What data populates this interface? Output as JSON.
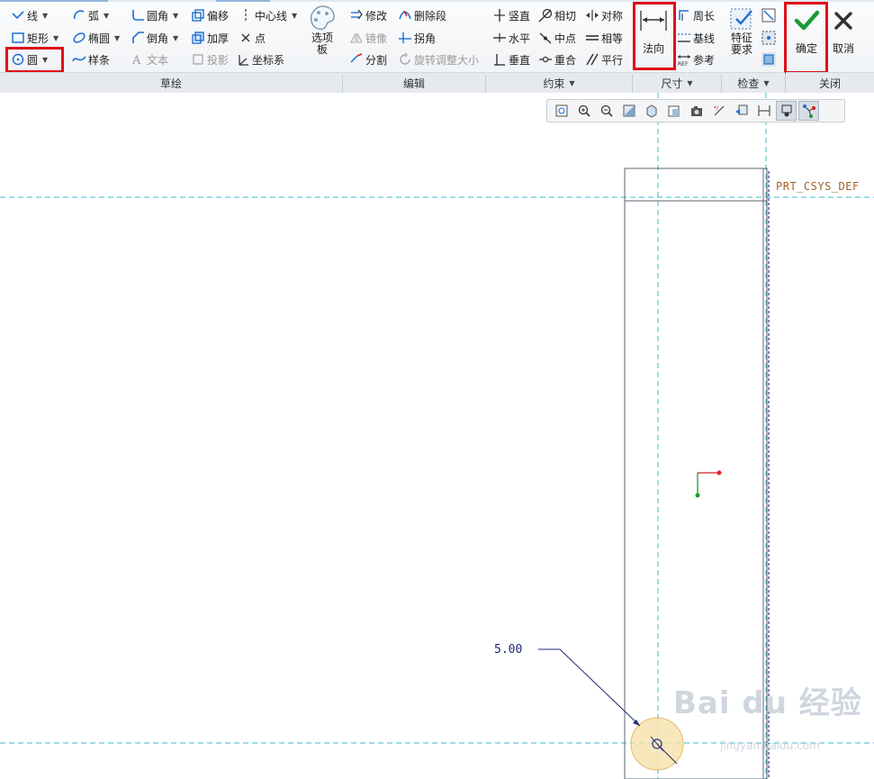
{
  "ribbon": {
    "sketch_tools": {
      "line": "线",
      "arc": "弧",
      "fillet": "圆角",
      "offset": "偏移",
      "centerline": "中心线",
      "rectangle": "矩形",
      "ellipse": "椭圆",
      "chamfer": "倒角",
      "thicken": "加厚",
      "point": "点",
      "circle": "圆",
      "spline": "样条",
      "text": "文本",
      "project": "投影",
      "coordinate_system": "坐标系",
      "palette": "选项板"
    },
    "edit_tools": {
      "modify": "修改",
      "delete_segment": "删除段",
      "mirror": "镜像",
      "corner": "拐角",
      "divide": "分割",
      "rotate_resize": "旋转调整大小"
    },
    "constrain_tools": {
      "vertical": "竖直",
      "tangent": "相切",
      "symmetric": "对称",
      "horizontal": "水平",
      "midpoint": "中点",
      "equal": "相等",
      "perpendicular": "垂直",
      "coincident": "重合",
      "parallel": "平行"
    },
    "dimension_tools": {
      "normal": "法向",
      "perimeter": "周长",
      "baseline": "基线",
      "reference": "参考"
    },
    "inspect_tools": {
      "feature_requirements": "特征要求"
    },
    "close_tools": {
      "ok": "确定",
      "cancel": "取消"
    },
    "groups": {
      "sketch": "草绘",
      "edit": "编辑",
      "constrain": "约束",
      "dimension": "尺寸",
      "inspect": "检查",
      "close": "关闭"
    }
  },
  "canvas": {
    "csys_label": "PRT_CSYS_DEF",
    "dimension_value": "5.00",
    "watermark_main": "Bai du 经验",
    "watermark_sub": "jingyan.baidu.com"
  },
  "colors": {
    "highlight": "#e0101a",
    "accept": "#1a9a3a",
    "datum": "#3fb8c8",
    "dimension": "#1f2a6e"
  }
}
